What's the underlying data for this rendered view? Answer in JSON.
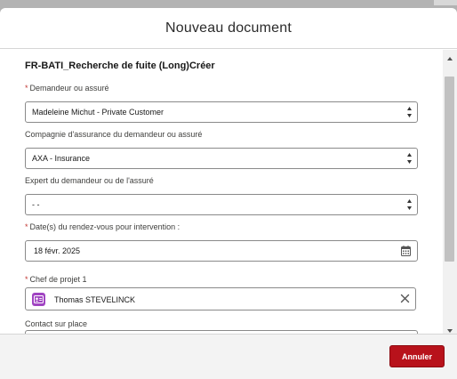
{
  "modal": {
    "title": "Nouveau document",
    "section_title": "FR-BATI_Recherche de fuite (Long)Créer"
  },
  "fields": {
    "demandeur": {
      "label": "Demandeur ou assuré",
      "required": true,
      "value": "Madeleine Michut - Private Customer"
    },
    "compagnie": {
      "label": "Compagnie d'assurance du demandeur ou assuré",
      "required": false,
      "value": "AXA - Insurance"
    },
    "expert": {
      "label": "Expert du demandeur ou de l'assuré",
      "required": false,
      "value": "- -"
    },
    "date_rdv": {
      "label": "Date(s) du rendez-vous pour intervention :",
      "required": true,
      "value": "18 févr. 2025"
    },
    "chef_projet": {
      "label": "Chef de projet 1",
      "required": true,
      "value": "Thomas STEVELINCK"
    },
    "contact": {
      "label": "Contact sur place",
      "required": false,
      "value": ""
    }
  },
  "footer": {
    "submit_label": "Annuler"
  },
  "colors": {
    "primary_button": "#b8121b",
    "required_marker": "#c23934",
    "contact_badge": "#a044c2"
  },
  "icons": [
    "select-arrows-icon",
    "calendar-icon",
    "contact-card-icon",
    "clear-icon",
    "scroll-up-icon",
    "scroll-down-icon"
  ]
}
